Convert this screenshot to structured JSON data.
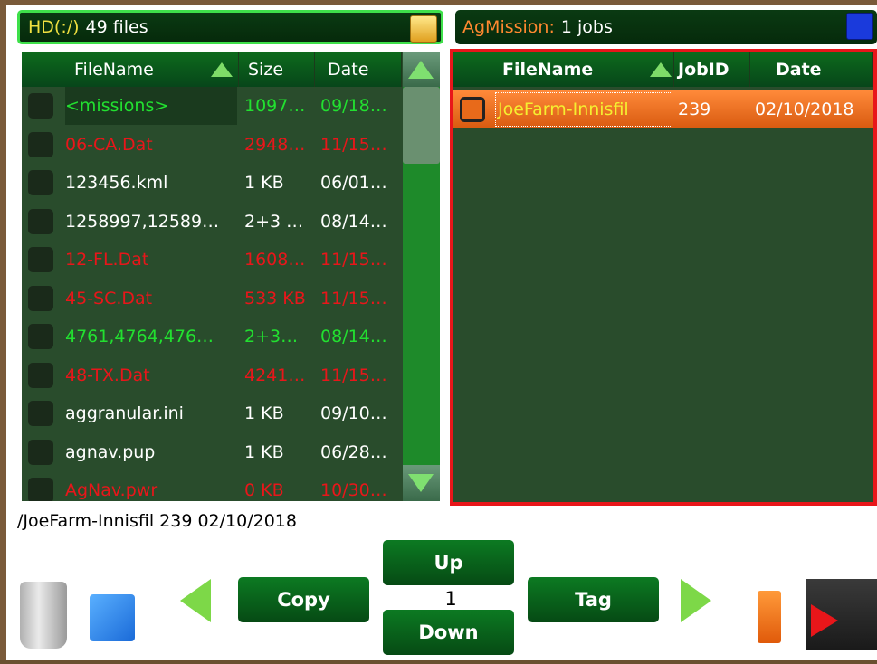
{
  "left_header": {
    "title_prefix": "HD(:/)",
    "title_suffix": "49 files",
    "icon": "folder-icon"
  },
  "right_header": {
    "title_prefix": "AgMission:",
    "title_suffix": "1 jobs",
    "icon": "network-icon"
  },
  "left_table": {
    "columns": [
      "FileName",
      "Size",
      "Date"
    ],
    "rows": [
      {
        "name": "<missions>",
        "size": "1097…",
        "date": "09/18…",
        "color": "#22e030"
      },
      {
        "name": "06-CA.Dat",
        "size": "2948…",
        "date": "11/15…",
        "color": "#e8161a"
      },
      {
        "name": "123456.kml",
        "size": "1 KB",
        "date": "06/01…",
        "color": "#ffffff"
      },
      {
        "name": "1258997,12589…",
        "size": "2+3 …",
        "date": "08/14…",
        "color": "#ffffff"
      },
      {
        "name": "12-FL.Dat",
        "size": "1608…",
        "date": "11/15…",
        "color": "#e8161a"
      },
      {
        "name": "45-SC.Dat",
        "size": "533 KB",
        "date": "11/15…",
        "color": "#e8161a"
      },
      {
        "name": "4761,4764,476…",
        "size": "2+3…",
        "date": "08/14…",
        "color": "#22e030"
      },
      {
        "name": "48-TX.Dat",
        "size": "4241…",
        "date": "11/15…",
        "color": "#e8161a"
      },
      {
        "name": "aggranular.ini",
        "size": "1 KB",
        "date": "09/10…",
        "color": "#ffffff"
      },
      {
        "name": "agnav.pup",
        "size": "1 KB",
        "date": "06/28…",
        "color": "#ffffff"
      },
      {
        "name": "AgNav.pwr",
        "size": "0 KB",
        "date": "10/30…",
        "color": "#e8161a"
      }
    ]
  },
  "right_table": {
    "columns": [
      "FileName",
      "JobID",
      "Date"
    ],
    "rows": [
      {
        "name": "JoeFarm-Innisfil",
        "jobid": "239",
        "date": "02/10/2018"
      }
    ]
  },
  "status_line": "/JoeFarm-Innisfil  239  02/10/2018",
  "buttons": {
    "copy": "Copy",
    "up": "Up",
    "down": "Down",
    "tag": "Tag",
    "page": "1"
  },
  "colors": {
    "panel_bg": "#294c2c",
    "accent_red": "#e8161a",
    "accent_green": "#22e030",
    "selected_row": "#e86a1a"
  }
}
